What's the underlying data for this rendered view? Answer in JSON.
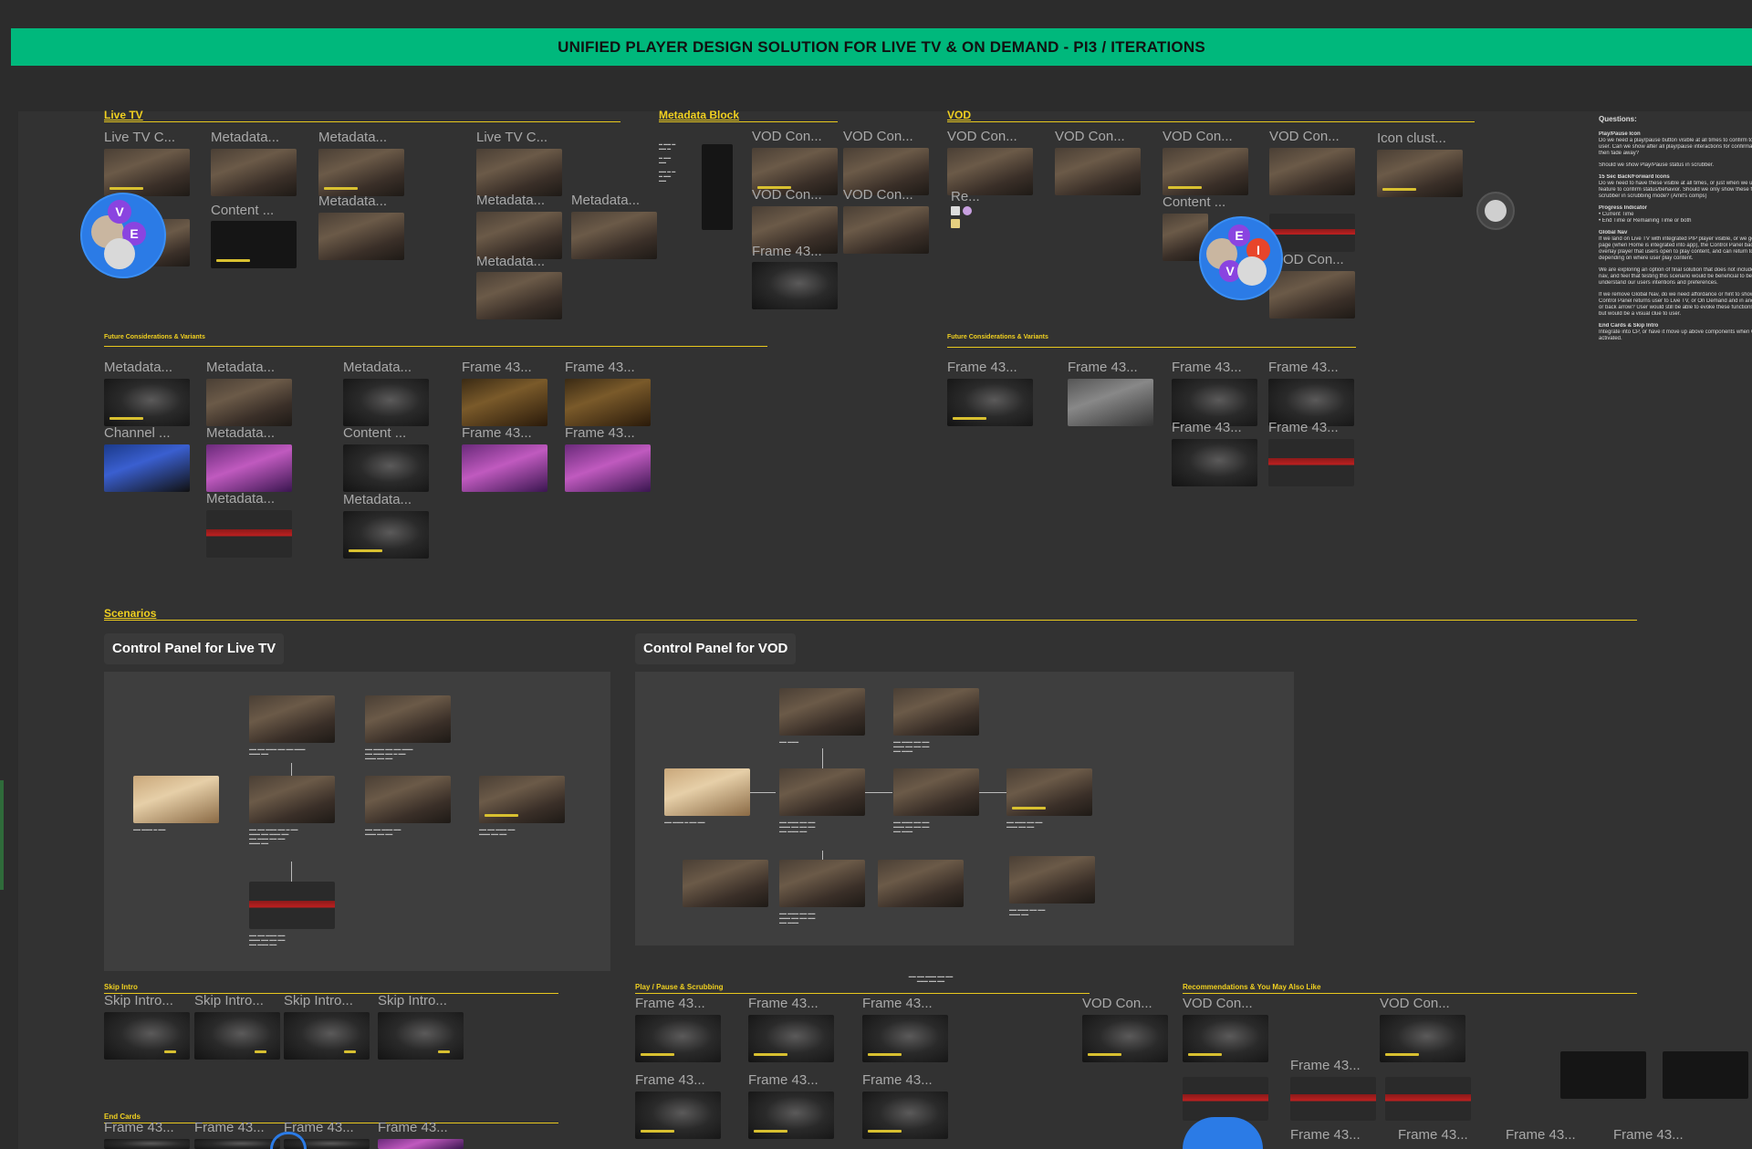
{
  "banner": {
    "title": "UNIFIED PLAYER DESIGN SOLUTION FOR LIVE TV & ON DEMAND - PI3 / ITERATIONS"
  },
  "sections": {
    "live_tv": "Live TV",
    "metadata_block": "Metadata Block",
    "vod": "VOD",
    "future_left": "Future Considerations & Variants",
    "future_right": "Future Considerations & Variants",
    "scenarios": "Scenarios",
    "skip_intro": "Skip Intro",
    "play_pause": "Play / Pause & Scrubbing",
    "recommendations": "Recommendations & You May Also Like",
    "end_cards": "End Cards"
  },
  "live_tv_frames": [
    "Live TV C...",
    "Metadata...",
    "Metadata...",
    "Live TV C...",
    "Content ...",
    "Metadata...",
    "Metadata...",
    "Metadata...",
    "Metadata..."
  ],
  "metadata_frames": [
    "VOD Con...",
    "VOD Con...",
    "VOD Con...",
    "VOD Con...",
    "Frame 43..."
  ],
  "vod_frames": [
    "VOD Con...",
    "VOD Con...",
    "VOD Con...",
    "VOD Con...",
    "Icon clust...",
    "Re...",
    "Content ...",
    "OD Con..."
  ],
  "future_left_frames": [
    "Metadata...",
    "Metadata...",
    "Metadata...",
    "Frame 43...",
    "Frame 43...",
    "Channel ...",
    "Metadata...",
    "Content ...",
    "Frame 43...",
    "Frame 43...",
    "Metadata...",
    "Metadata..."
  ],
  "future_right_frames": [
    "Frame 43...",
    "Frame 43...",
    "Frame 43...",
    "Frame 43...",
    "Frame 43...",
    "Frame 43..."
  ],
  "scenarios": {
    "live_panel_title": "Control Panel for Live TV",
    "vod_panel_title": "Control Panel for VOD"
  },
  "skip_intro_frames": [
    "Skip Intro...",
    "Skip Intro...",
    "Skip Intro...",
    "Skip Intro..."
  ],
  "play_pause_frames": [
    "Frame 43...",
    "Frame 43...",
    "Frame 43...",
    "Frame 43...",
    "Frame 43...",
    "Frame 43...",
    "VOD Con..."
  ],
  "recommendation_frames": [
    "VOD Con...",
    "VOD Con...",
    "Frame 43...",
    "Frame 43...",
    "Frame 43...",
    "Frame 43...",
    "Frame 43..."
  ],
  "end_card_frames": [
    "Frame 43...",
    "Frame 43...",
    "Frame 43...",
    "Frame 43..."
  ],
  "questions": {
    "title": "Questions:",
    "items": [
      "Play/Pause Icon",
      "Do we need a play/pause button visible at all times to confirm to",
      "user. Can we show after all play/pause interactions for confirmation",
      "then fade away?",
      "Should we show Play/Pause status in scrubber.",
      "15 Sec Back/Forward Icons",
      "Do we need to have these visible at all times, or just when we use",
      "feature to confirm status/behavior. Should we only show these fo",
      "scrubber in scrubbing mode? (Amit's comps)",
      "Progress Indicator",
      "• Current Time",
      "• End Time or Remaining Time or both",
      "Global Nav",
      "If we land on Live TV with integrated PIP player visible, or we go",
      "page (when Home is integrated into app), the Control Panel bac",
      "overlay player that users open to play content, and can return to",
      "depending on where user play content.",
      "We are exploring an option of final solution that does not include",
      "nav, and feel that testing this scenario would be beneficial to be",
      "understand our users intentions and preferences.",
      "If we remove Global Nav, do we need affordance or hint to show",
      "Control Panel returns user to Live TV, or On Demand and in and",
      "or back arrow? User would still be able to evoke these functions",
      "but would be a visual clue to user.",
      "End Cards & Skip Intro",
      "Integrate into CP, or have it move up above components when C",
      "activated."
    ]
  },
  "collaborators": {
    "group1": [
      "V",
      "E"
    ],
    "group2": [
      "E",
      "I",
      "V"
    ]
  },
  "colors": {
    "accent": "#00b87c",
    "section": "#f0d020",
    "canvas": "#2c2c2c",
    "avatar": "#2b7be6"
  }
}
